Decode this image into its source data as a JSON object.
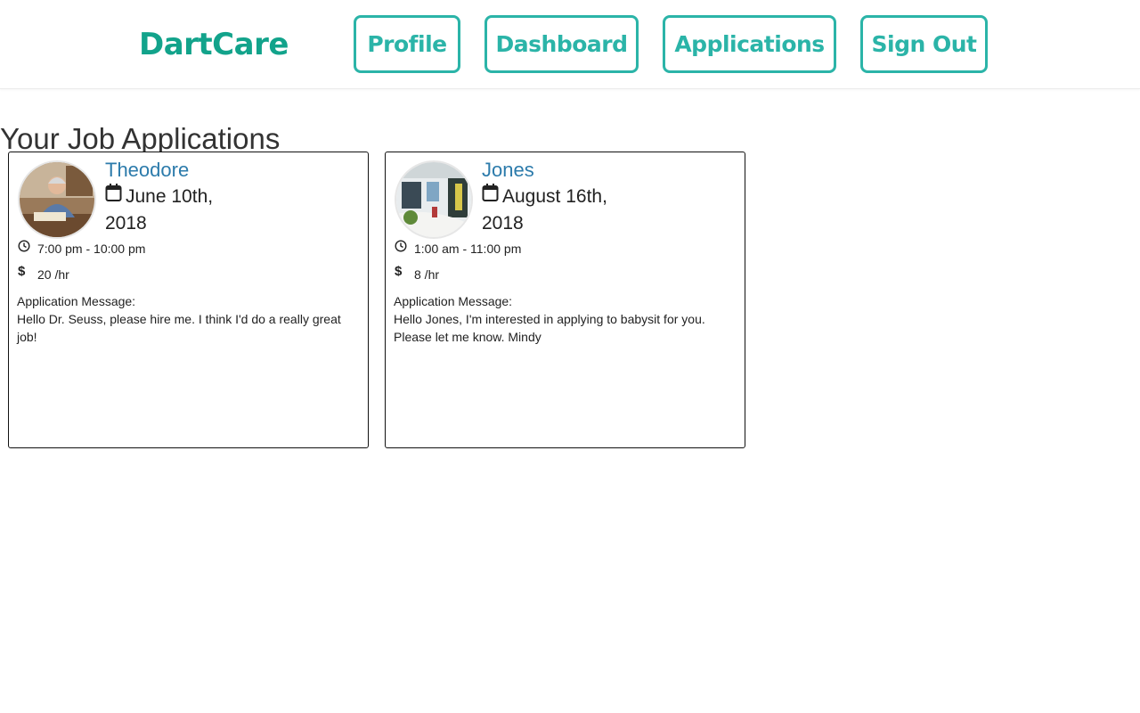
{
  "header": {
    "logo": "DartCare",
    "nav": {
      "profile": "Profile",
      "dashboard": "Dashboard",
      "applications": "Applications",
      "sign_out": "Sign Out"
    }
  },
  "page": {
    "title": "Your Job Applications"
  },
  "applications": [
    {
      "family_name": "Theodore",
      "date": "June 10th, 2018",
      "time": "7:00 pm - 10:00 pm",
      "rate": "20 /hr",
      "message_label": "Application Message:",
      "message": "Hello Dr. Seuss, please hire me. I think I'd do a really great job!"
    },
    {
      "family_name": "Jones",
      "date": "August 16th, 2018",
      "time": "1:00 am - 11:00 pm",
      "rate": "8 /hr",
      "message_label": "Application Message:",
      "message": "Hello Jones, I'm interested in applying to babysit for you. Please let me know. Mindy"
    }
  ],
  "icons": {
    "calendar": "calendar-icon",
    "clock": "clock-icon",
    "dollar": "$"
  },
  "colors": {
    "brand": "#12a38b",
    "nav_accent": "#2bb4a8",
    "link": "#2c7bab"
  }
}
